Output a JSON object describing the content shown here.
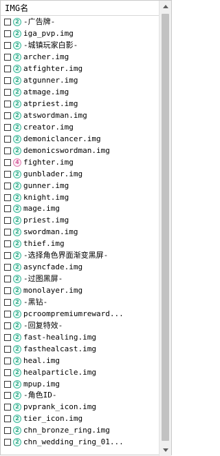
{
  "header": {
    "label": "IMG名"
  },
  "colors": {
    "badge_green": "#3bb89a",
    "badge_pink": "#e07bb0",
    "scroll_thumb": "#c2c2c2"
  },
  "items": [
    {
      "name": "-广告牌-",
      "badge": "2",
      "badge_color": "green"
    },
    {
      "name": "iga_pvp.img",
      "badge": "2",
      "badge_color": "green"
    },
    {
      "name": "-城镇玩家白影-",
      "badge": "2",
      "badge_color": "green"
    },
    {
      "name": "archer.img",
      "badge": "2",
      "badge_color": "green"
    },
    {
      "name": "atfighter.img",
      "badge": "2",
      "badge_color": "green"
    },
    {
      "name": "atgunner.img",
      "badge": "2",
      "badge_color": "green"
    },
    {
      "name": "atmage.img",
      "badge": "2",
      "badge_color": "green"
    },
    {
      "name": "atpriest.img",
      "badge": "2",
      "badge_color": "green"
    },
    {
      "name": "atswordman.img",
      "badge": "2",
      "badge_color": "green"
    },
    {
      "name": "creator.img",
      "badge": "2",
      "badge_color": "green"
    },
    {
      "name": "demoniclancer.img",
      "badge": "2",
      "badge_color": "green"
    },
    {
      "name": "demonicswordman.img",
      "badge": "2",
      "badge_color": "green"
    },
    {
      "name": "fighter.img",
      "badge": "4",
      "badge_color": "pink"
    },
    {
      "name": "gunblader.img",
      "badge": "2",
      "badge_color": "green"
    },
    {
      "name": "gunner.img",
      "badge": "2",
      "badge_color": "green"
    },
    {
      "name": "knight.img",
      "badge": "2",
      "badge_color": "green"
    },
    {
      "name": "mage.img",
      "badge": "2",
      "badge_color": "green"
    },
    {
      "name": "priest.img",
      "badge": "2",
      "badge_color": "green"
    },
    {
      "name": "swordman.img",
      "badge": "2",
      "badge_color": "green"
    },
    {
      "name": "thief.img",
      "badge": "2",
      "badge_color": "green"
    },
    {
      "name": "-选择角色界面渐变黑屏-",
      "badge": "2",
      "badge_color": "green"
    },
    {
      "name": "asyncfade.img",
      "badge": "2",
      "badge_color": "green"
    },
    {
      "name": "-过图黑屏-",
      "badge": "2",
      "badge_color": "green"
    },
    {
      "name": "monolayer.img",
      "badge": "2",
      "badge_color": "green"
    },
    {
      "name": "-黑钻-",
      "badge": "2",
      "badge_color": "green"
    },
    {
      "name": "pcroompremiumreward...",
      "badge": "2",
      "badge_color": "green"
    },
    {
      "name": "-回复特效-",
      "badge": "2",
      "badge_color": "green"
    },
    {
      "name": "fast-healing.img",
      "badge": "2",
      "badge_color": "green"
    },
    {
      "name": "fasthealcast.img",
      "badge": "2",
      "badge_color": "green"
    },
    {
      "name": "heal.img",
      "badge": "2",
      "badge_color": "green"
    },
    {
      "name": "healparticle.img",
      "badge": "2",
      "badge_color": "green"
    },
    {
      "name": "mpup.img",
      "badge": "2",
      "badge_color": "green"
    },
    {
      "name": "-角色ID-",
      "badge": "2",
      "badge_color": "green"
    },
    {
      "name": "pvprank_icon.img",
      "badge": "2",
      "badge_color": "green"
    },
    {
      "name": "tier_icon.img",
      "badge": "2",
      "badge_color": "green"
    },
    {
      "name": "chn_bronze_ring.img",
      "badge": "2",
      "badge_color": "green"
    },
    {
      "name": "chn_wedding_ring_01...",
      "badge": "2",
      "badge_color": "green"
    }
  ]
}
